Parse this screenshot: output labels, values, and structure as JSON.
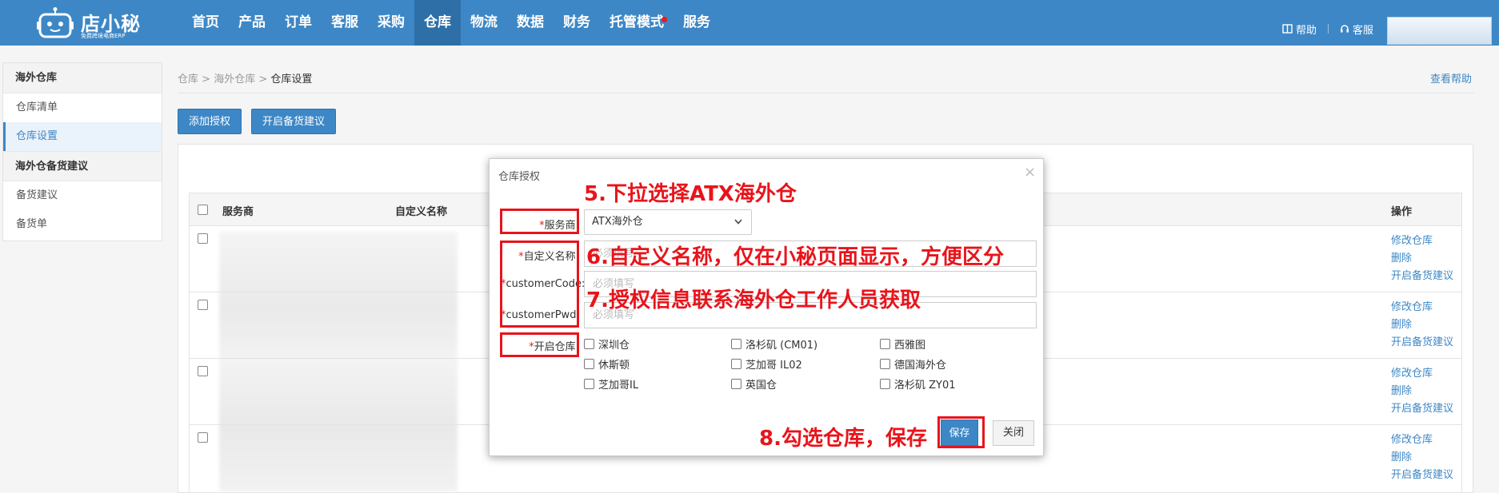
{
  "app": {
    "logo_name": "店小秘",
    "logo_sub": "免费跨境电商ERP"
  },
  "nav": {
    "items": [
      {
        "label": "首页"
      },
      {
        "label": "产品"
      },
      {
        "label": "订单"
      },
      {
        "label": "客服"
      },
      {
        "label": "采购"
      },
      {
        "label": "仓库"
      },
      {
        "label": "物流"
      },
      {
        "label": "数据"
      },
      {
        "label": "财务"
      },
      {
        "label": "托管模式"
      },
      {
        "label": "服务"
      }
    ],
    "active": "仓库"
  },
  "top_right": {
    "help": "帮助",
    "service": "客服"
  },
  "sidebar": {
    "groups": [
      {
        "title": "海外仓库",
        "items": [
          "仓库清单",
          "仓库设置"
        ]
      },
      {
        "title": "海外仓备货建议",
        "items": [
          "备货建议",
          "备货单"
        ]
      }
    ],
    "active_item": "仓库设置"
  },
  "breadcrumb": {
    "items": [
      "仓库",
      "海外仓库"
    ],
    "current": "仓库设置",
    "sep": " > "
  },
  "help_link": "查看帮助",
  "toolbar": {
    "add_auth": "添加授权",
    "enable_stock": "开启备货建议"
  },
  "table": {
    "headers": {
      "provider": "服务商",
      "custom_name": "自定义名称",
      "actions": "操作"
    },
    "row_actions": [
      "修改仓库",
      "删除",
      "开启备货建议"
    ],
    "row_count": 4
  },
  "dialog": {
    "title": "仓库授权",
    "close": "×",
    "fields": {
      "provider_label": "服务商:",
      "provider_value": "ATX海外仓",
      "custom_name_label": "自定义名称:",
      "custom_name_placeholder": "必须填写",
      "customer_code_label": "customerCode:",
      "customer_code_placeholder": "必须填写",
      "customer_pwd_label": "customerPwd:",
      "customer_pwd_placeholder": "必须填写",
      "open_warehouse_label": "开启仓库:",
      "required_mark": "*"
    },
    "warehouses": [
      {
        "label": "深圳仓",
        "checked": false
      },
      {
        "label": "洛杉矶 (CM01)",
        "checked": false
      },
      {
        "label": "西雅图",
        "checked": false
      },
      {
        "label": "休斯顿",
        "checked": false
      },
      {
        "label": "芝加哥 IL02",
        "checked": false
      },
      {
        "label": "德国海外仓",
        "checked": false
      },
      {
        "label": "芝加哥IL",
        "checked": false
      },
      {
        "label": "英国仓",
        "checked": false
      },
      {
        "label": "洛杉矶 ZY01",
        "checked": false
      }
    ],
    "save": "保存",
    "cancel": "关闭"
  },
  "annotations": {
    "step5": "5.下拉选择ATX海外仓",
    "step6": "6.自定义名称，仅在小秘页面显示，方便区分",
    "step7": "7.授权信息联系海外仓工作人员获取",
    "step8": "8.勾选仓库，保存"
  },
  "colors": {
    "primary": "#3d87c6",
    "annotation_red": "#e8141b",
    "topbar": "#3d87c6"
  }
}
